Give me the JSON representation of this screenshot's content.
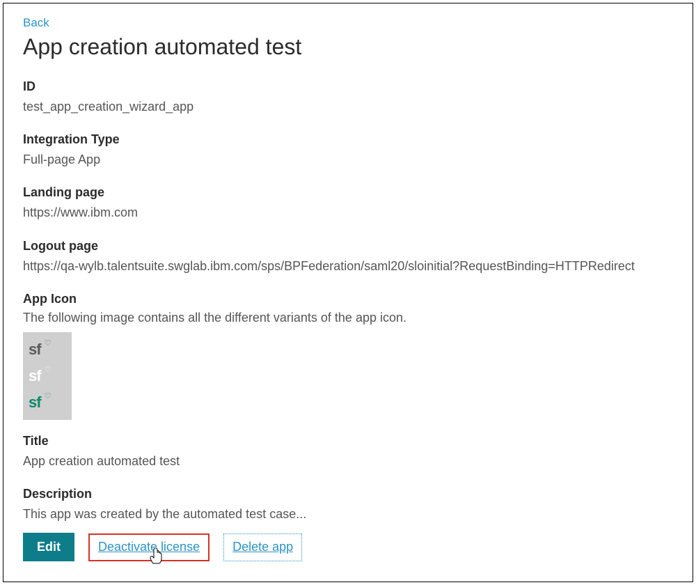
{
  "back_label": "Back",
  "page_title": "App creation automated test",
  "sections": {
    "id": {
      "label": "ID",
      "value": "test_app_creation_wizard_app"
    },
    "integration_type": {
      "label": "Integration Type",
      "value": "Full-page App"
    },
    "landing_page": {
      "label": "Landing page",
      "value": "https://www.ibm.com"
    },
    "logout_page": {
      "label": "Logout page",
      "value": "https://qa-wylb.talentsuite.swglab.ibm.com/sps/BPFederation/saml20/sloinitial?RequestBinding=HTTPRedirect"
    },
    "app_icon": {
      "label": "App Icon",
      "description": "The following image contains all the different variants of the app icon."
    },
    "title": {
      "label": "Title",
      "value": "App creation automated test"
    },
    "description": {
      "label": "Description",
      "value": "This app was created by the automated test case..."
    }
  },
  "actions": {
    "edit": "Edit",
    "deactivate": "Deactivate license",
    "delete": "Delete app"
  },
  "icon_glyph": "sf",
  "icon_heart": "♡"
}
